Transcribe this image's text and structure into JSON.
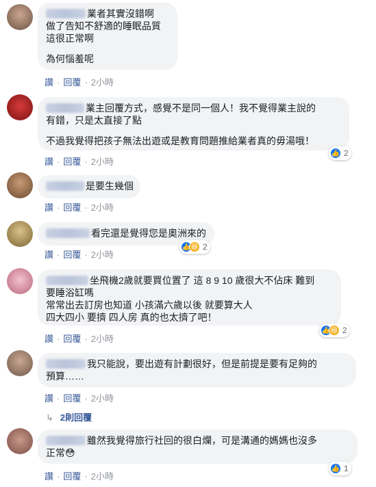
{
  "comments": [
    {
      "lines": [
        "業者其實沒錯啊",
        "做了告知不舒適的睡眠品質",
        "這很正常啊",
        "",
        "為何惱羞呢"
      ],
      "actions": {
        "like": "讚",
        "reply": "回覆",
        "time": "2小時"
      }
    },
    {
      "lines": [
        "業主回覆方式，感覺不是同一個人！我不覺得業主說的",
        "有錯，只是太直接了點",
        "",
        "不過我覺得把孩子無法出遊或是教育問題推給業者真的毋湯哦！"
      ],
      "actions": {
        "like": "讚",
        "reply": "回覆",
        "time": "2小時"
      },
      "reactions": {
        "count": "2"
      }
    },
    {
      "lines": [
        "是要生幾個"
      ],
      "actions": {
        "like": "讚",
        "reply": "回覆",
        "time": "2小時"
      }
    },
    {
      "lines": [
        "看完還是覺得您是奧洲來的"
      ],
      "actions": {
        "like": "讚",
        "reply": "回覆",
        "time": "2小時"
      },
      "reactions": {
        "count": "2"
      }
    },
    {
      "lines": [
        "坐飛機2歲就要買位置了 這 8 9 10 歲很大不佔床 難到",
        "要睡浴缸嗎",
        "常常出去訂房也知道 小孩滿六歲以後 就要算大人",
        "四大四小 要擠 四人房 真的也太擠了吧！"
      ],
      "actions": {
        "like": "讚",
        "reply": "回覆",
        "time": "2小時"
      },
      "reactions": {
        "count": "2"
      }
    },
    {
      "lines": [
        "我只能說，要出遊有計劃很好，但是前提是要有足夠的",
        "預算……"
      ],
      "actions": {
        "like": "讚",
        "reply": "回覆",
        "time": "2小時"
      }
    },
    {
      "lines": [
        "雖然我覺得旅行社回的很白爛，可是溝通的媽媽也沒多",
        "正常😳"
      ],
      "actions": {
        "like": "讚",
        "reply": "回覆",
        "time": "2小時"
      },
      "reactions": {
        "count": "1"
      }
    }
  ],
  "replies_link": {
    "arrow": "↳",
    "label": "2則回覆"
  },
  "icons": {
    "like": "thumbs-up-icon",
    "haha": "laughing-face-icon"
  },
  "colors": {
    "bubble": "#f2f3f5",
    "link": "#385898",
    "meta": "#90949c",
    "like": "#1877f2",
    "haha": "#f7b125"
  }
}
